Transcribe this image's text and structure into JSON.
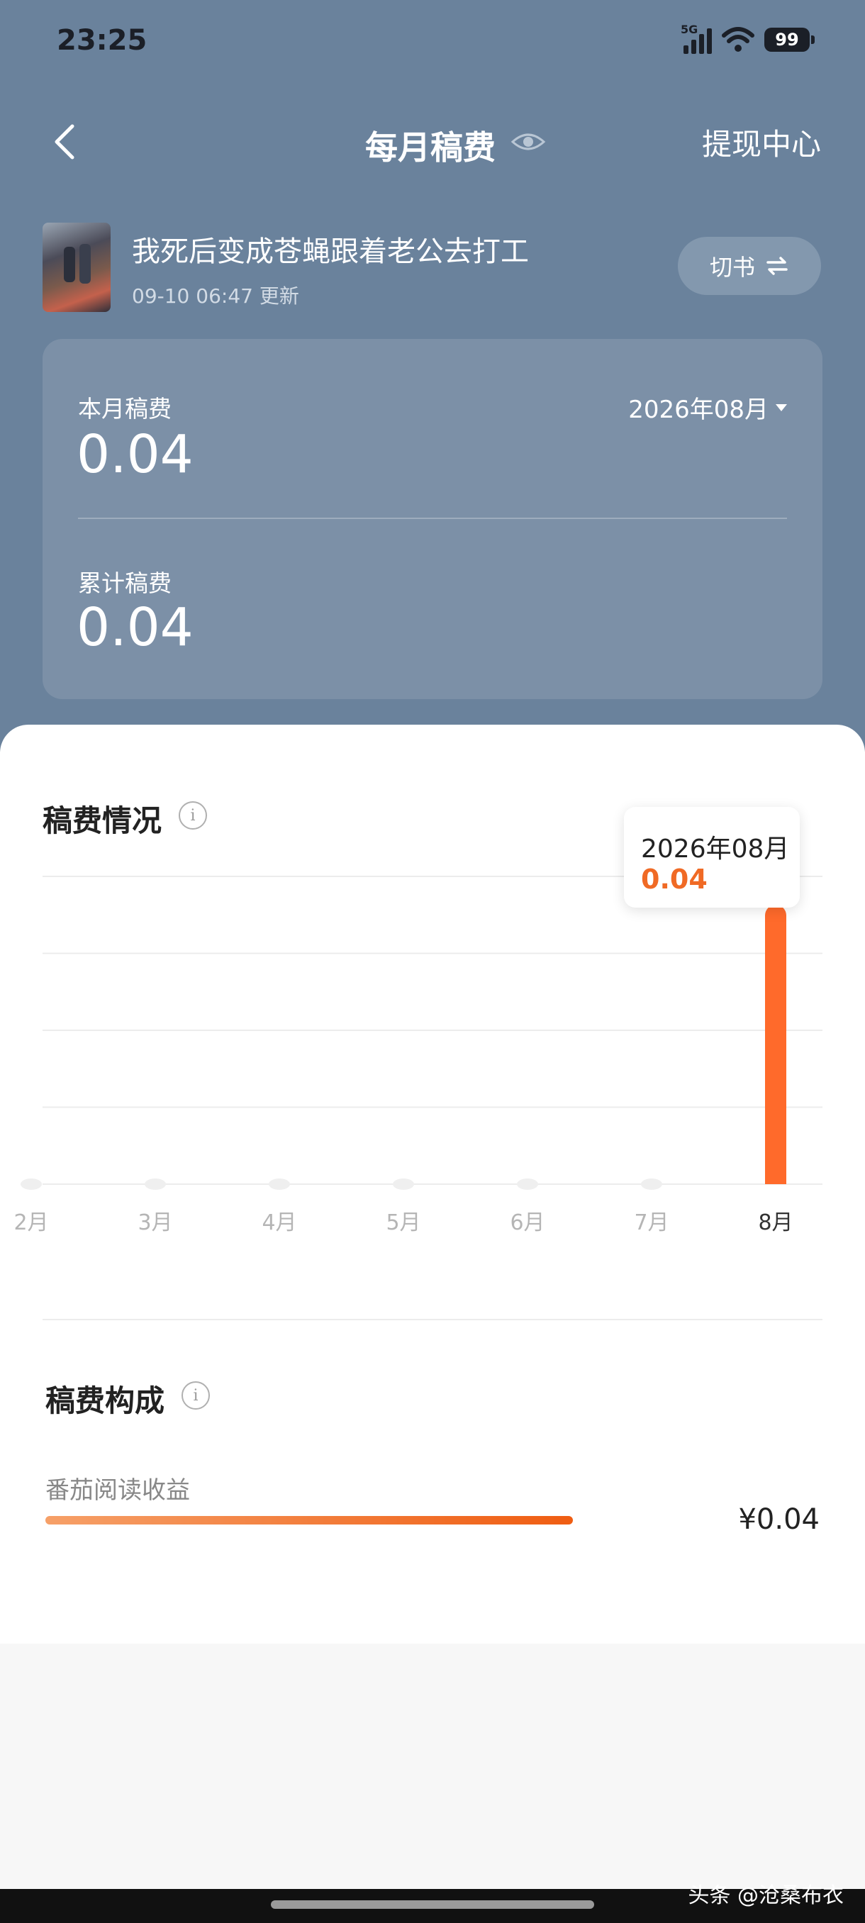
{
  "status": {
    "time": "23:25",
    "network": "5G",
    "battery": "99"
  },
  "nav": {
    "title": "每月稿费",
    "withdraw": "提现中心"
  },
  "book": {
    "title": "我死后变成苍蝇跟着老公去打工",
    "updated": "09-10 06:47 更新",
    "switch_label": "切书"
  },
  "earnings": {
    "month_label": "本月稿费",
    "month_value": "0.04",
    "month_select": "2026年08月",
    "total_label": "累计稿费",
    "total_value": "0.04"
  },
  "chart_section": {
    "title": "稿费情况"
  },
  "tooltip": {
    "date": "2026年08月",
    "value": "0.04"
  },
  "chart_data": {
    "type": "bar",
    "categories": [
      "2月",
      "3月",
      "4月",
      "5月",
      "6月",
      "7月",
      "8月"
    ],
    "values": [
      0,
      0,
      0,
      0,
      0,
      0,
      0.04
    ],
    "ylim": [
      0,
      0.04
    ],
    "grid": true,
    "highlight_color": "#ff6a2b"
  },
  "composition": {
    "title": "稿费构成",
    "item_label": "番茄阅读收益",
    "item_value": "¥0.04",
    "item_share": 1.0
  },
  "watermark": "头条 @沧桑布衣",
  "colors": {
    "header_bg": "#6a829c",
    "card_bg": "#7c90a7",
    "accent": "#f06a25"
  }
}
